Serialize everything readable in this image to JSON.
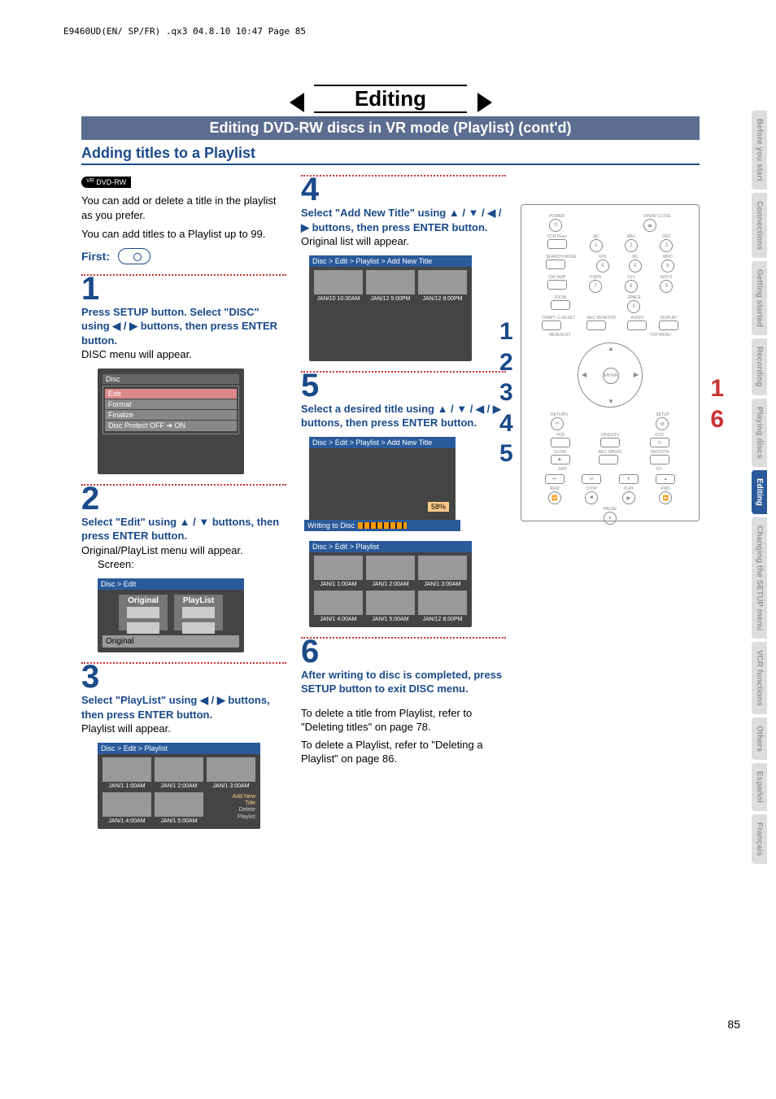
{
  "header_path": "E9460UD(EN/ SP/FR) .qx3  04.8.10  10:47  Page 85",
  "title": "Editing",
  "subtitle": "Editing DVD-RW discs in VR mode (Playlist) (cont'd)",
  "section_heading": "Adding titles to a Playlist",
  "disc_badge": "DVD-RW",
  "disc_badge_sup": "VR",
  "intro1": "You can add or delete a title in the playlist as you prefer.",
  "intro2": "You can add titles to a Playlist up to 99.",
  "first_label": "First:",
  "steps": {
    "1": {
      "num": "1",
      "bold": "Press SETUP button. Select \"DISC\" using ◀ / ▶ buttons, then press ENTER button.",
      "plain": "DISC menu will appear."
    },
    "2": {
      "num": "2",
      "bold": "Select \"Edit\" using ▲ / ▼ buttons, then press ENTER button.",
      "plain": "Original/PlayList menu will appear.",
      "screen_label": "Screen:"
    },
    "3": {
      "num": "3",
      "bold": "Select \"PlayList\" using ◀ / ▶ buttons, then press ENTER button.",
      "plain": "Playlist will appear."
    },
    "4": {
      "num": "4",
      "bold": "Select \"Add New Title\" using ▲ / ▼ / ◀ / ▶ buttons, then press ENTER button.",
      "plain": "Original list will appear."
    },
    "5": {
      "num": "5",
      "bold": "Select a desired title using ▲ / ▼ / ◀ / ▶ buttons, then press ENTER button."
    },
    "6": {
      "num": "6",
      "bold": "After writing to disc is completed, press SETUP button to exit DISC menu.",
      "para1": "To delete a title from Playlist, refer to \"Deleting titles\" on page 78.",
      "para2": "To delete a Playlist, refer to \"Deleting a Playlist\" on page 86."
    }
  },
  "disc_menu": {
    "title": "Disc",
    "items": [
      "Edit",
      "Format",
      "Finalize",
      "Disc Protect OFF ➔ ON"
    ]
  },
  "edit_menu": {
    "breadcrumb": "Disc > Edit",
    "original": "Original",
    "playlist": "PlayList",
    "footer": "Original"
  },
  "playlist_menu": {
    "breadcrumb": "Disc > Edit > Playlist",
    "thumbs": [
      "JAN/1   1:00AM",
      "JAN/1   2:00AM",
      "JAN/1   3:00AM",
      "JAN/1   4:00AM",
      "JAN/1   5:00AM"
    ],
    "extra": {
      "line1": "Add  New",
      "line2": "Title",
      "line3": "Delete",
      "line4": "Playlist"
    }
  },
  "addnew_menu": {
    "breadcrumb": "Disc > Edit > Playlist > Add New Title",
    "thumbs": [
      "JAN/10 10:30AM",
      "JAN/12   5:00PM",
      "JAN/12   8:00PM"
    ]
  },
  "writing_menu": {
    "breadcrumb": "Disc > Edit > Playlist > Add New Title",
    "percent": "58%",
    "label": "Writing to Disc"
  },
  "playlist_after": {
    "breadcrumb": "Disc > Edit > Playlist",
    "thumbs": [
      "JAN/1   1:00AM",
      "JAN/1   2:00AM",
      "JAN/1   3:00AM",
      "JAN/1   4:00AM",
      "JAN/1   5:00AM",
      "JAN/12   8:00PM"
    ]
  },
  "remote_numbers_blue": [
    "1",
    "2",
    "3",
    "4",
    "5"
  ],
  "remote_numbers_red": [
    "1",
    "6"
  ],
  "remote": {
    "power": "POWER",
    "open": "OPEN/\nCLOSE",
    "vcr_plus": "VCR Plus+",
    "row2": [
      ".@/:",
      "ABC",
      "DEF"
    ],
    "nums1": [
      "1",
      "2",
      "3"
    ],
    "row3": [
      "SEARCH\nMODE",
      "GHI",
      "JKL",
      "MNO"
    ],
    "nums2": [
      "4",
      "5",
      "6"
    ],
    "row4": [
      "CM SKIP",
      "PQRS",
      "TUV",
      "WXYZ"
    ],
    "nums3": [
      "7",
      "8",
      "9"
    ],
    "row5": [
      "ZOOM",
      "",
      "SPACE",
      ""
    ],
    "num0": "0",
    "row6": [
      "CHAPT.\nC.RESET",
      "REC\nMONITOR",
      "AUDIO",
      "DISPLAY"
    ],
    "row7": [
      "MENU/LIST",
      "",
      "",
      "TOP MENU"
    ],
    "enter": "ENTER",
    "returnl": "RETURN",
    "setup": "SETUP",
    "row8": [
      "VCR",
      "VIDEO/TV",
      "DVD"
    ],
    "row9": [
      "SLOW",
      "REC\nSPEED",
      "REC/OTR"
    ],
    "row10": [
      "SKIP",
      "",
      "CH"
    ],
    "row11": [
      "REW",
      "STOP",
      "PLAY",
      "FWD"
    ],
    "pause": "PAUSE"
  },
  "side_tabs": [
    "Before you start",
    "Connections",
    "Getting started",
    "Recording",
    "Playing discs",
    "Editing",
    "Changing the SETUP menu",
    "VCR functions",
    "Others",
    "Español",
    "Français"
  ],
  "active_tab_index": 5,
  "page_number": "85"
}
